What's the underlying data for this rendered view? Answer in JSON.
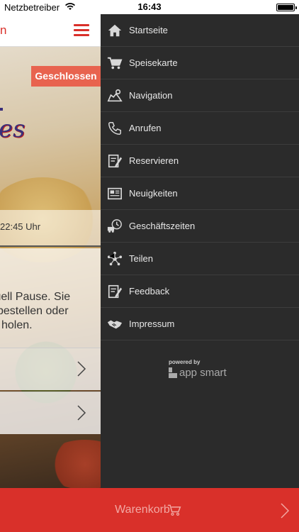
{
  "status_bar": {
    "carrier": "Netzbetreiber",
    "time": "16:43"
  },
  "main": {
    "title_fragment": "n",
    "closed_badge": "Geschlossen",
    "logo_fragment": "es",
    "hours_fragment": "22:45 Uhr",
    "notice_lines": [
      "tuell Pause. Sie",
      "bestellen oder",
      "holen."
    ]
  },
  "menu": {
    "items": [
      {
        "label": "Startseite",
        "icon": "home-icon"
      },
      {
        "label": "Speisekarte",
        "icon": "cart-icon"
      },
      {
        "label": "Navigation",
        "icon": "map-icon"
      },
      {
        "label": "Anrufen",
        "icon": "phone-icon"
      },
      {
        "label": "Reservieren",
        "icon": "reserve-icon"
      },
      {
        "label": "Neuigkeiten",
        "icon": "news-icon"
      },
      {
        "label": "Geschäftszeiten",
        "icon": "delivery-clock-icon"
      },
      {
        "label": "Teilen",
        "icon": "share-icon"
      },
      {
        "label": "Feedback",
        "icon": "feedback-icon"
      },
      {
        "label": "Impressum",
        "icon": "handshake-icon"
      }
    ],
    "powered_by": "powered by",
    "brand": "app smart"
  },
  "cart": {
    "label": "Warenkorb"
  },
  "colors": {
    "accent_red": "#d9302a",
    "menu_bg": "#2b2b2b",
    "badge_bg": "#e8634f"
  }
}
